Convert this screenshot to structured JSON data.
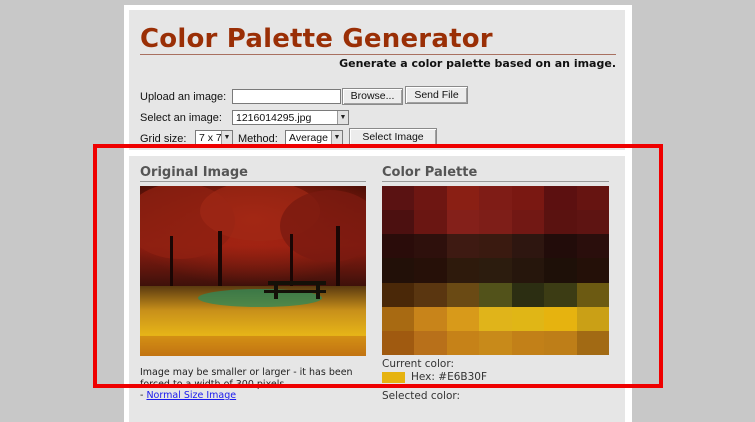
{
  "header": {
    "title": "Color Palette Generator",
    "subtitle": "Generate a color palette based on an image."
  },
  "form": {
    "upload_label": "Upload an image:",
    "upload_value": "",
    "browse_label": "Browse...",
    "send_file_label": "Send File",
    "select_label": "Select an image:",
    "select_value": "1216014295.jpg",
    "grid_label": "Grid size:",
    "grid_value": "7 x 7",
    "method_label": "Method:",
    "method_value": "Average",
    "select_image_label": "Select Image"
  },
  "original": {
    "heading": "Original Image",
    "caption": "Image may be smaller or larger - it has been forced to a width of 300 pixels.",
    "link_prefix": "- ",
    "link_label": "Normal Size Image"
  },
  "palette": {
    "heading": "Color Palette",
    "rows": [
      [
        "#5a1212",
        "#6e1612",
        "#8a1f14",
        "#7f1c16",
        "#7a1812",
        "#5c1010",
        "#661411"
      ],
      [
        "#4c1010",
        "#6a1612",
        "#84201a",
        "#7e1e18",
        "#721814",
        "#5a1210",
        "#5e1412"
      ],
      [
        "#2a0c0a",
        "#2e100c",
        "#3e1a12",
        "#3a1a10",
        "#2e1610",
        "#220c0a",
        "#2a0e0c"
      ],
      [
        "#221008",
        "#261008",
        "#2e1a0c",
        "#2c1c0e",
        "#26160c",
        "#1e1008",
        "#241008"
      ],
      [
        "#4a2808",
        "#5a3610",
        "#6a4a14",
        "#52521a",
        "#2c2e12",
        "#3c3c14",
        "#6c5a12"
      ],
      [
        "#a86a12",
        "#c8841a",
        "#d89a1a",
        "#e0b41a",
        "#e0b616",
        "#e6b30f",
        "#caa016"
      ],
      [
        "#a05a10",
        "#b8701a",
        "#c68218",
        "#c88a1a",
        "#c28018",
        "#be7e18",
        "#a26a14"
      ]
    ],
    "current_label": "Current color:",
    "current_hex_label": "Hex:",
    "current_hex": "#E6B30F",
    "current_color": "#E6B30F",
    "selected_label": "Selected color:"
  },
  "highlight_color": "#EF0000"
}
